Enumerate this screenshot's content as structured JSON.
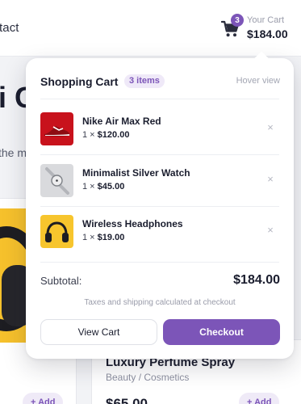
{
  "nav": {
    "link_fragment": "tact"
  },
  "cart_trigger": {
    "badge_count": "3",
    "caption": "Your Cart",
    "amount": "$184.00"
  },
  "background": {
    "hero_title_fragment": "i C",
    "hero_sub_fragment": "the m",
    "right_product": {
      "title": "Luxury Perfume Spray",
      "category": "Beauty / Cosmetics",
      "price": "$65.00"
    },
    "add_label": "+ Add"
  },
  "cart_popup": {
    "title": "Shopping Cart",
    "count_badge": "3 items",
    "hint": "Hover view",
    "items": [
      {
        "name": "Nike Air Max Red",
        "qty_prefix": "1 ×",
        "price": "$120.00",
        "thumb_icon": "red-sneaker-icon",
        "remove_icon": "×"
      },
      {
        "name": "Minimalist Silver Watch",
        "qty_prefix": "1 ×",
        "price": "$45.00",
        "thumb_icon": "silver-watch-icon",
        "remove_icon": "×"
      },
      {
        "name": "Wireless Headphones",
        "qty_prefix": "1 ×",
        "price": "$19.00",
        "thumb_icon": "headphones-icon",
        "remove_icon": "×"
      }
    ],
    "subtotal_label": "Subtotal:",
    "subtotal_value": "$184.00",
    "tax_note": "Taxes and shipping calculated at checkout",
    "view_cart_label": "View Cart",
    "checkout_label": "Checkout"
  },
  "colors": {
    "accent": "#7c55b8",
    "accent_soft": "#efe9f8",
    "text": "#1a1d2e",
    "muted": "#9a9caa"
  }
}
